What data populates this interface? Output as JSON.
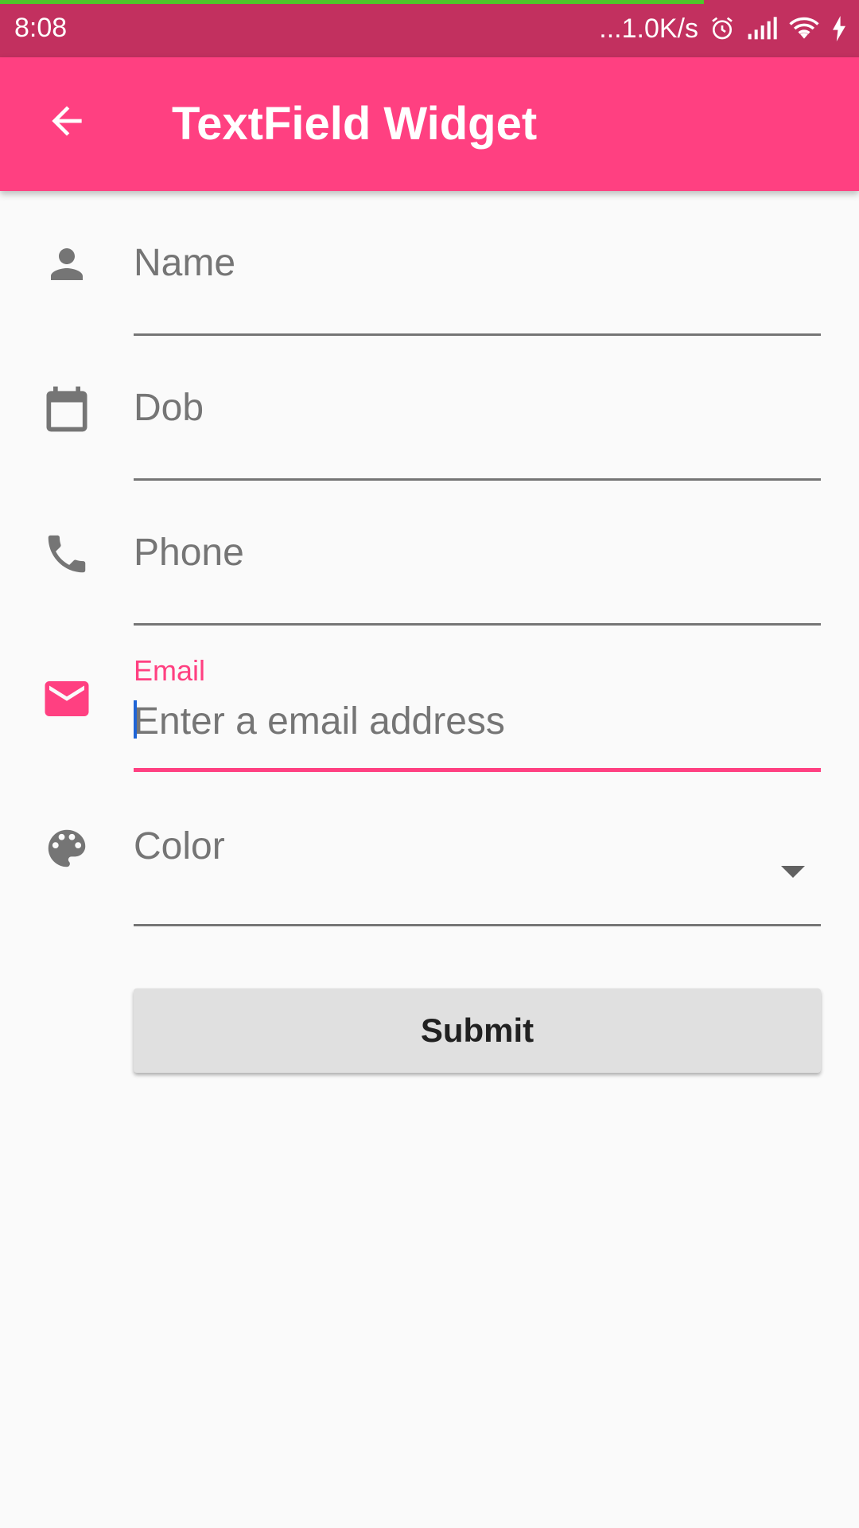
{
  "status_bar": {
    "time": "8:08",
    "network_speed": "...1.0K/s",
    "icons": [
      "alarm-icon",
      "signal-icon",
      "wifi-icon",
      "charging-icon"
    ],
    "progress_color": "#4fc62a"
  },
  "app_bar": {
    "title": "TextField Widget",
    "back_icon": "arrow-back-icon",
    "color": "#ff4081"
  },
  "form": {
    "name": {
      "icon": "person-icon",
      "placeholder": "Name",
      "value": ""
    },
    "dob": {
      "icon": "calendar-icon",
      "placeholder": "Dob",
      "value": ""
    },
    "phone": {
      "icon": "phone-icon",
      "placeholder": "Phone",
      "value": ""
    },
    "email": {
      "icon": "email-icon",
      "label": "Email",
      "placeholder": "Enter a email address",
      "value": "",
      "focused": true
    },
    "color": {
      "icon": "palette-icon",
      "value": "Color",
      "arrow_icon": "arrow-drop-down-icon"
    },
    "submit_label": "Submit"
  },
  "colors": {
    "accent": "#ff4081",
    "icon_gray": "#757575",
    "background": "#fafafa"
  }
}
